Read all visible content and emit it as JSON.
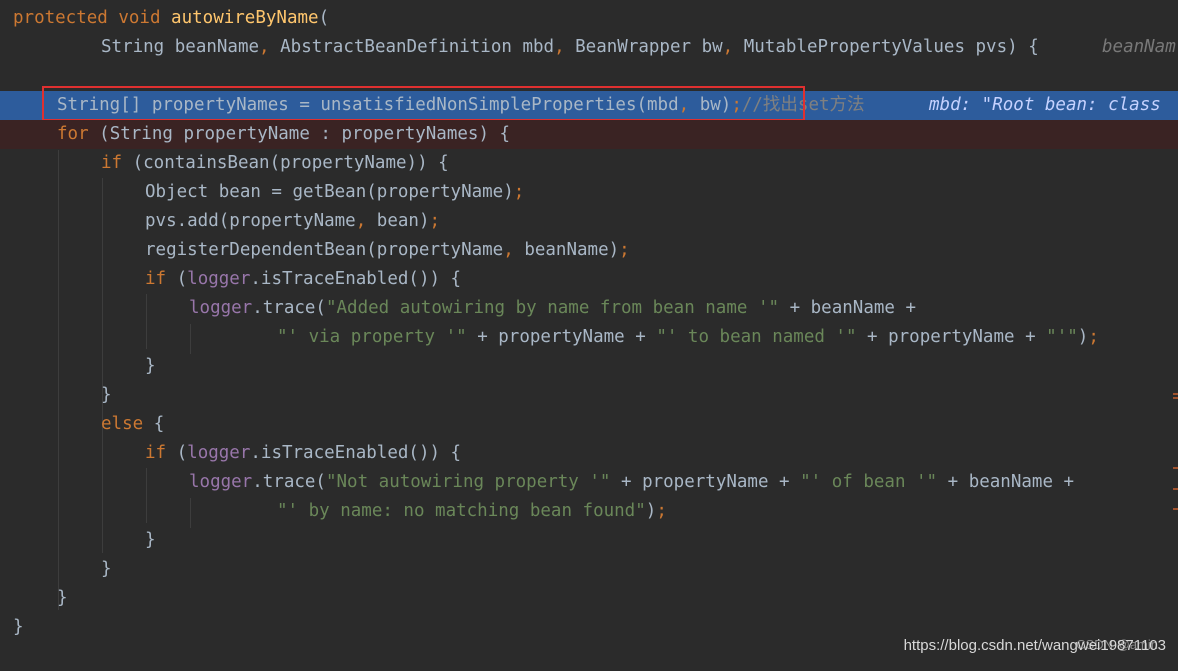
{
  "lines": {
    "l1": {
      "kw": "protected void ",
      "fn": "autowireByName",
      "rest": "("
    },
    "l2": {
      "p1": "String beanName",
      "c1": ", ",
      "p2": "AbstractBeanDefinition mbd",
      "c2": ", ",
      "p3": "BeanWrapper bw",
      "c3": ", ",
      "p4": "MutablePropertyValues pvs) {",
      "hint": "beanNam"
    },
    "l4": {
      "code": "String[] propertyNames = unsatisfiedNonSimpleProperties(mbd",
      "comma": ", ",
      "code2": "bw)",
      "semi": ";",
      "comment": "//找出set方法",
      "hint": "mbd: \"Root bean: class"
    },
    "l5": {
      "kw": "for ",
      "rest": "(String propertyName : propertyNames) {"
    },
    "l6": {
      "kw": "if ",
      "rest": "(containsBean(propertyName)) {"
    },
    "l7": {
      "code": "Object bean = getBean(propertyName)",
      "semi": ";"
    },
    "l8": {
      "code": "pvs.add(propertyName",
      "comma": ", ",
      "code2": "bean)",
      "semi": ";"
    },
    "l9": {
      "code": "registerDependentBean(propertyName",
      "comma": ", ",
      "code2": "beanName)",
      "semi": ";"
    },
    "l10": {
      "kw": "if ",
      "open": "(",
      "fld": "logger",
      "rest": ".isTraceEnabled()) {"
    },
    "l11": {
      "fld": "logger",
      "call": ".trace(",
      "str": "\"Added autowiring by name from bean name '\"",
      "rest": " + beanName +"
    },
    "l12": {
      "str1": "\"' via property '\"",
      "mid1": " + propertyName + ",
      "str2": "\"' to bean named '\"",
      "mid2": " + propertyName + ",
      "str3": "\"'\"",
      "close": ")",
      "semi": ";"
    },
    "l13": {
      "code": "}"
    },
    "l14": {
      "code": "}"
    },
    "l15": {
      "kw": "else ",
      "rest": "{"
    },
    "l16": {
      "kw": "if ",
      "open": "(",
      "fld": "logger",
      "rest": ".isTraceEnabled()) {"
    },
    "l17": {
      "fld": "logger",
      "call": ".trace(",
      "str1": "\"Not autowiring property '\"",
      "mid1": " + propertyName + ",
      "str2": "\"' of bean '\"",
      "rest": " + beanName +"
    },
    "l18": {
      "str": "\"' by name: no matching bean found\"",
      "close": ")",
      "semi": ";"
    },
    "l19": {
      "code": "}"
    },
    "l20": {
      "code": "}"
    },
    "l21": {
      "code": "}"
    },
    "l22": {
      "code": "}"
    }
  },
  "watermark": {
    "url": "https://blog.csdn.net/wangwei19871103",
    "csdn": "CSDN @amin"
  },
  "colors": {
    "background": "#2b2b2b",
    "keyword": "#cc7832",
    "function": "#ffc66d",
    "string": "#6a8759",
    "field": "#9876aa",
    "exec_line": "#2d5c9c",
    "breakpoint_line": "#3a2323",
    "highlight_box": "#e03030"
  }
}
